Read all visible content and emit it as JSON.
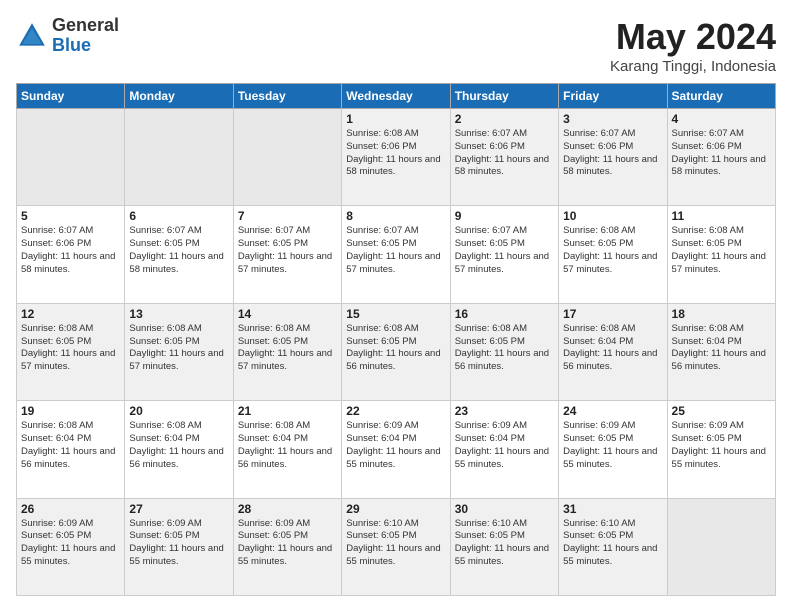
{
  "logo": {
    "general": "General",
    "blue": "Blue"
  },
  "title": "May 2024",
  "subtitle": "Karang Tinggi, Indonesia",
  "weekdays": [
    "Sunday",
    "Monday",
    "Tuesday",
    "Wednesday",
    "Thursday",
    "Friday",
    "Saturday"
  ],
  "rows": [
    [
      {
        "day": "",
        "info": ""
      },
      {
        "day": "",
        "info": ""
      },
      {
        "day": "",
        "info": ""
      },
      {
        "day": "1",
        "info": "Sunrise: 6:08 AM\nSunset: 6:06 PM\nDaylight: 11 hours\nand 58 minutes."
      },
      {
        "day": "2",
        "info": "Sunrise: 6:07 AM\nSunset: 6:06 PM\nDaylight: 11 hours\nand 58 minutes."
      },
      {
        "day": "3",
        "info": "Sunrise: 6:07 AM\nSunset: 6:06 PM\nDaylight: 11 hours\nand 58 minutes."
      },
      {
        "day": "4",
        "info": "Sunrise: 6:07 AM\nSunset: 6:06 PM\nDaylight: 11 hours\nand 58 minutes."
      }
    ],
    [
      {
        "day": "5",
        "info": "Sunrise: 6:07 AM\nSunset: 6:06 PM\nDaylight: 11 hours\nand 58 minutes."
      },
      {
        "day": "6",
        "info": "Sunrise: 6:07 AM\nSunset: 6:05 PM\nDaylight: 11 hours\nand 58 minutes."
      },
      {
        "day": "7",
        "info": "Sunrise: 6:07 AM\nSunset: 6:05 PM\nDaylight: 11 hours\nand 57 minutes."
      },
      {
        "day": "8",
        "info": "Sunrise: 6:07 AM\nSunset: 6:05 PM\nDaylight: 11 hours\nand 57 minutes."
      },
      {
        "day": "9",
        "info": "Sunrise: 6:07 AM\nSunset: 6:05 PM\nDaylight: 11 hours\nand 57 minutes."
      },
      {
        "day": "10",
        "info": "Sunrise: 6:08 AM\nSunset: 6:05 PM\nDaylight: 11 hours\nand 57 minutes."
      },
      {
        "day": "11",
        "info": "Sunrise: 6:08 AM\nSunset: 6:05 PM\nDaylight: 11 hours\nand 57 minutes."
      }
    ],
    [
      {
        "day": "12",
        "info": "Sunrise: 6:08 AM\nSunset: 6:05 PM\nDaylight: 11 hours\nand 57 minutes."
      },
      {
        "day": "13",
        "info": "Sunrise: 6:08 AM\nSunset: 6:05 PM\nDaylight: 11 hours\nand 57 minutes."
      },
      {
        "day": "14",
        "info": "Sunrise: 6:08 AM\nSunset: 6:05 PM\nDaylight: 11 hours\nand 57 minutes."
      },
      {
        "day": "15",
        "info": "Sunrise: 6:08 AM\nSunset: 6:05 PM\nDaylight: 11 hours\nand 56 minutes."
      },
      {
        "day": "16",
        "info": "Sunrise: 6:08 AM\nSunset: 6:05 PM\nDaylight: 11 hours\nand 56 minutes."
      },
      {
        "day": "17",
        "info": "Sunrise: 6:08 AM\nSunset: 6:04 PM\nDaylight: 11 hours\nand 56 minutes."
      },
      {
        "day": "18",
        "info": "Sunrise: 6:08 AM\nSunset: 6:04 PM\nDaylight: 11 hours\nand 56 minutes."
      }
    ],
    [
      {
        "day": "19",
        "info": "Sunrise: 6:08 AM\nSunset: 6:04 PM\nDaylight: 11 hours\nand 56 minutes."
      },
      {
        "day": "20",
        "info": "Sunrise: 6:08 AM\nSunset: 6:04 PM\nDaylight: 11 hours\nand 56 minutes."
      },
      {
        "day": "21",
        "info": "Sunrise: 6:08 AM\nSunset: 6:04 PM\nDaylight: 11 hours\nand 56 minutes."
      },
      {
        "day": "22",
        "info": "Sunrise: 6:09 AM\nSunset: 6:04 PM\nDaylight: 11 hours\nand 55 minutes."
      },
      {
        "day": "23",
        "info": "Sunrise: 6:09 AM\nSunset: 6:04 PM\nDaylight: 11 hours\nand 55 minutes."
      },
      {
        "day": "24",
        "info": "Sunrise: 6:09 AM\nSunset: 6:05 PM\nDaylight: 11 hours\nand 55 minutes."
      },
      {
        "day": "25",
        "info": "Sunrise: 6:09 AM\nSunset: 6:05 PM\nDaylight: 11 hours\nand 55 minutes."
      }
    ],
    [
      {
        "day": "26",
        "info": "Sunrise: 6:09 AM\nSunset: 6:05 PM\nDaylight: 11 hours\nand 55 minutes."
      },
      {
        "day": "27",
        "info": "Sunrise: 6:09 AM\nSunset: 6:05 PM\nDaylight: 11 hours\nand 55 minutes."
      },
      {
        "day": "28",
        "info": "Sunrise: 6:09 AM\nSunset: 6:05 PM\nDaylight: 11 hours\nand 55 minutes."
      },
      {
        "day": "29",
        "info": "Sunrise: 6:10 AM\nSunset: 6:05 PM\nDaylight: 11 hours\nand 55 minutes."
      },
      {
        "day": "30",
        "info": "Sunrise: 6:10 AM\nSunset: 6:05 PM\nDaylight: 11 hours\nand 55 minutes."
      },
      {
        "day": "31",
        "info": "Sunrise: 6:10 AM\nSunset: 6:05 PM\nDaylight: 11 hours\nand 55 minutes."
      },
      {
        "day": "",
        "info": ""
      }
    ]
  ],
  "shaded_rows": [
    0,
    2,
    4
  ]
}
